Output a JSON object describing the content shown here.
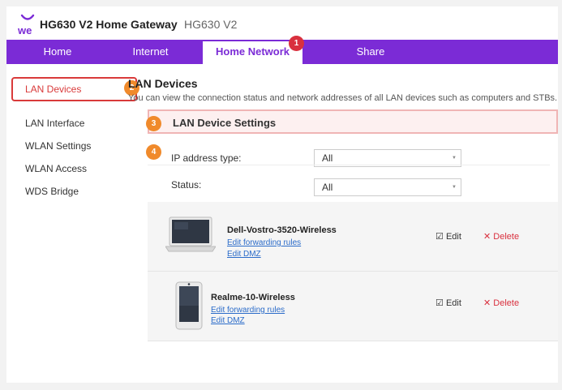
{
  "header": {
    "logo_text": "we",
    "title": "HG630 V2 Home Gateway",
    "model": "HG630 V2"
  },
  "nav": {
    "tabs": [
      {
        "label": "Home"
      },
      {
        "label": "Internet"
      },
      {
        "label": "Home Network",
        "active": true
      },
      {
        "label": "Share"
      }
    ]
  },
  "badges": [
    "1",
    "2",
    "3",
    "4"
  ],
  "sidebar": {
    "items": [
      {
        "label": "LAN Devices",
        "active": true
      },
      {
        "label": "LAN Interface"
      },
      {
        "label": "WLAN Settings"
      },
      {
        "label": "WLAN Access"
      },
      {
        "label": "WDS Bridge"
      }
    ]
  },
  "main": {
    "title": "LAN Devices",
    "description": "You can view the connection status and network addresses of all LAN devices such as computers and STBs.",
    "section_title": "LAN Device Settings",
    "filters": {
      "ip_type_label": "IP address type:",
      "ip_type_value": "All",
      "status_label": "Status:",
      "status_value": "All"
    },
    "devices": [
      {
        "name": "Dell-Vostro-3520-Wireless",
        "type": "laptop",
        "links": [
          "Edit forwarding rules",
          "Edit DMZ"
        ],
        "edit_label": "Edit",
        "delete_label": "Delete"
      },
      {
        "name": "Realme-10-Wireless",
        "type": "phone",
        "links": [
          "Edit forwarding rules",
          "Edit DMZ"
        ],
        "edit_label": "Edit",
        "delete_label": "Delete"
      }
    ]
  },
  "colors": {
    "brand": "#7b2bd6",
    "highlight": "#d93a3a",
    "badge_red": "#d9303e",
    "badge_orange": "#f08a2b",
    "link": "#2a6bc9"
  },
  "icons": {
    "edit": "☑",
    "delete": "✕",
    "caret": "▼"
  }
}
